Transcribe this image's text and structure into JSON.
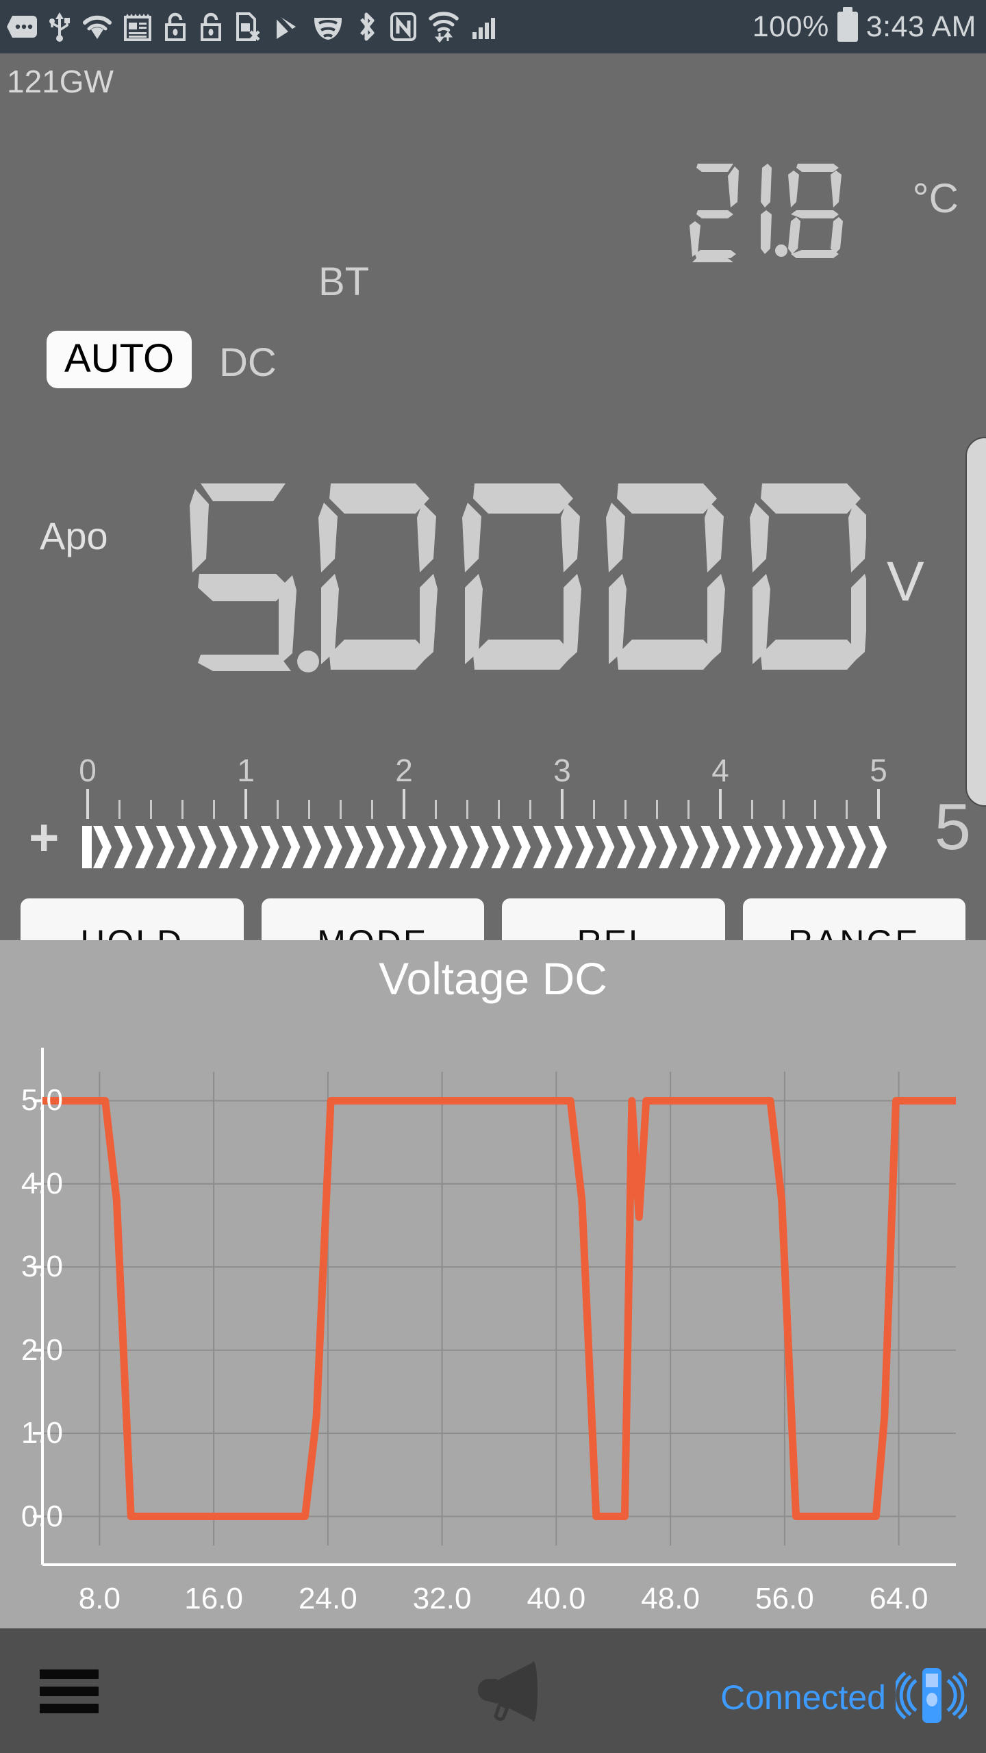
{
  "statusbar": {
    "icons": [
      "more-dots-icon",
      "usb-icon",
      "wifi-icon",
      "news-icon",
      "unlock-icon",
      "unlock-alt-icon",
      "sim-card-removed-icon",
      "play-store-icon",
      "vpn-shield-icon",
      "bluetooth-icon",
      "nfc-icon",
      "wifi-transfer-icon",
      "cellular-signal-icon"
    ],
    "battery_percent": "100%",
    "battery_icon": "battery-full-icon",
    "time": "3:43 AM"
  },
  "meter": {
    "model": "121GW",
    "bt_label": "BT",
    "auto_label": "AUTO",
    "dc_label": "DC",
    "apo_label": "Apo",
    "temperature": "21.8",
    "temperature_unit": "°C",
    "main_value": "5.0000",
    "main_unit": "V",
    "bargraph": {
      "plus_label": "+",
      "range_label": "5",
      "ticks": [
        "0",
        "1",
        "2",
        "3",
        "4",
        "5"
      ],
      "fill_fraction": 1.0
    },
    "buttons": [
      {
        "label": "HOLD",
        "name": "hold-button"
      },
      {
        "label": "MODE",
        "name": "mode-button"
      },
      {
        "label": "REL",
        "name": "rel-button"
      },
      {
        "label": "RANGE",
        "name": "range-button"
      }
    ]
  },
  "chart_data": {
    "type": "line",
    "title": "Voltage DC",
    "xlabel": "",
    "ylabel": "",
    "line_color": "#ee6039",
    "grid": true,
    "legend": null,
    "xlim": [
      4.0,
      68.0
    ],
    "ylim": [
      -0.35,
      5.35
    ],
    "xticks": [
      8.0,
      16.0,
      24.0,
      32.0,
      40.0,
      48.0,
      56.0,
      64.0
    ],
    "xtick_labels": [
      "8.0",
      "16.0",
      "24.0",
      "32.0",
      "40.0",
      "48.0",
      "56.0",
      "64.0"
    ],
    "yticks": [
      0.0,
      1.0,
      2.0,
      3.0,
      4.0,
      5.0
    ],
    "ytick_labels": [
      "0.0",
      "1.0",
      "2.0",
      "3.0",
      "4.0",
      "5.0"
    ],
    "series": [
      {
        "name": "Voltage DC",
        "x": [
          4.0,
          8.4,
          9.2,
          10.2,
          22.4,
          23.2,
          24.2,
          41.0,
          41.8,
          42.8,
          44.8,
          45.3,
          45.8,
          46.3,
          47.0,
          55.0,
          55.8,
          56.8,
          62.4,
          63.0,
          63.8,
          68.0
        ],
        "y": [
          5.0,
          5.0,
          3.8,
          0.0,
          0.0,
          1.2,
          5.0,
          5.0,
          3.8,
          0.0,
          0.0,
          5.0,
          3.6,
          5.0,
          5.0,
          5.0,
          3.8,
          0.0,
          0.0,
          1.2,
          5.0,
          5.0
        ]
      }
    ]
  },
  "navbar": {
    "menu_icon": "hamburger-menu-icon",
    "speaker_icon": "megaphone-icon",
    "connection_status": "Connected",
    "connection_icon": "meter-connected-icon",
    "connection_color": "#3e9bff"
  }
}
